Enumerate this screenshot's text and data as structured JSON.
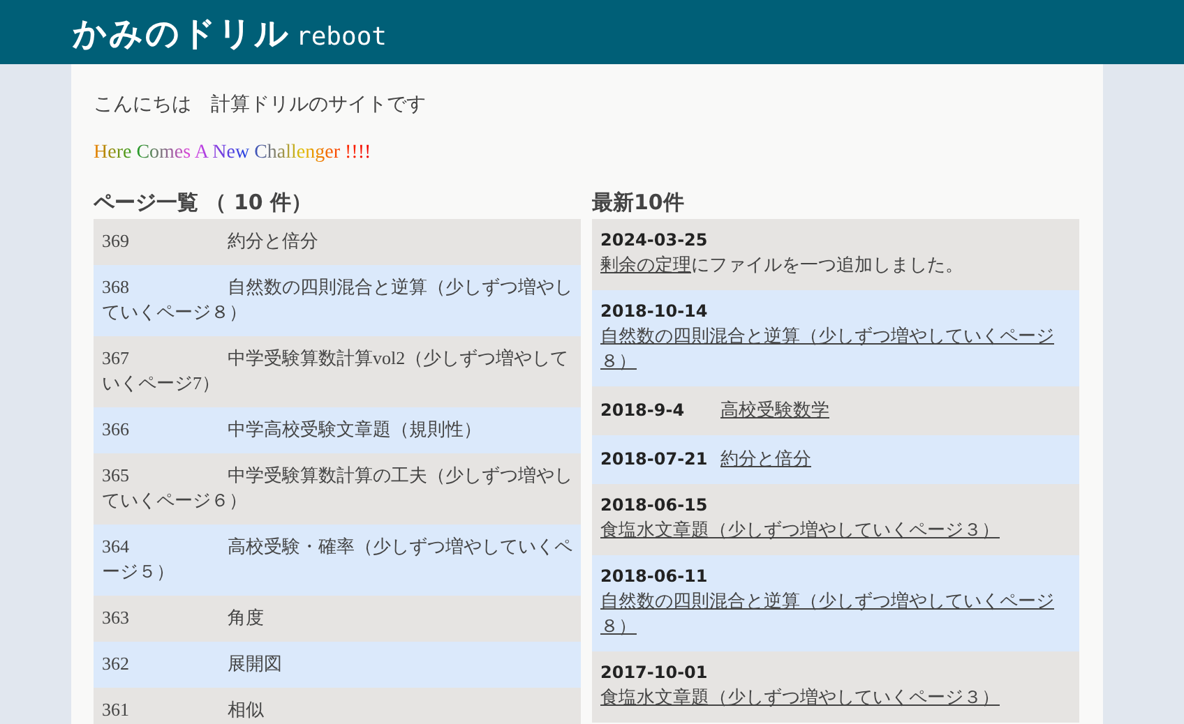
{
  "header": {
    "logo": "かみのドリル",
    "logo_suffix": "reboot"
  },
  "greeting": "こんにちは　計算ドリルのサイトです",
  "banner": "Here Comes A New Challenger !!!!",
  "page_list": {
    "title": "ページ一覧 （ 10 件）",
    "rows": [
      {
        "number": "369",
        "title": "約分と倍分"
      },
      {
        "number": "368",
        "title": "自然数の四則混合と逆算（少しずつ増やしていくページ８）"
      },
      {
        "number": "367",
        "title": "中学受験算数計算vol2（少しずつ増やしていくページ7）"
      },
      {
        "number": "366",
        "title": "中学高校受験文章題（規則性）"
      },
      {
        "number": "365",
        "title": "中学受験算数計算の工夫（少しずつ増やしていくページ６）"
      },
      {
        "number": "364",
        "title": "高校受験・確率（少しずつ増やしていくページ５）"
      },
      {
        "number": "363",
        "title": "角度"
      },
      {
        "number": "362",
        "title": "展開図"
      },
      {
        "number": "361",
        "title": "相似"
      }
    ]
  },
  "news": {
    "title": "最新10件",
    "items": [
      {
        "kind": "stacked",
        "date": "2024-03-25",
        "link": "剰余の定理",
        "text": "にファイルを一つ追加しました。"
      },
      {
        "kind": "stacked",
        "date": "2018-10-14",
        "link": "自然数の四則混合と逆算（少しずつ増やしていくページ８）"
      },
      {
        "kind": "inline",
        "date": "2018-9-4",
        "link": "高校受験数学"
      },
      {
        "kind": "inline",
        "date": "2018-07-21",
        "link": "約分と倍分"
      },
      {
        "kind": "stacked",
        "date": "2018-06-15",
        "link": "食塩水文章題（少しずつ増やしていくページ３）"
      },
      {
        "kind": "stacked",
        "date": "2018-06-11",
        "link": "自然数の四則混合と逆算（少しずつ増やしていくページ８）"
      },
      {
        "kind": "stacked",
        "date": "2017-10-01",
        "link": "食塩水文章題（少しずつ増やしていくページ３）"
      }
    ]
  }
}
